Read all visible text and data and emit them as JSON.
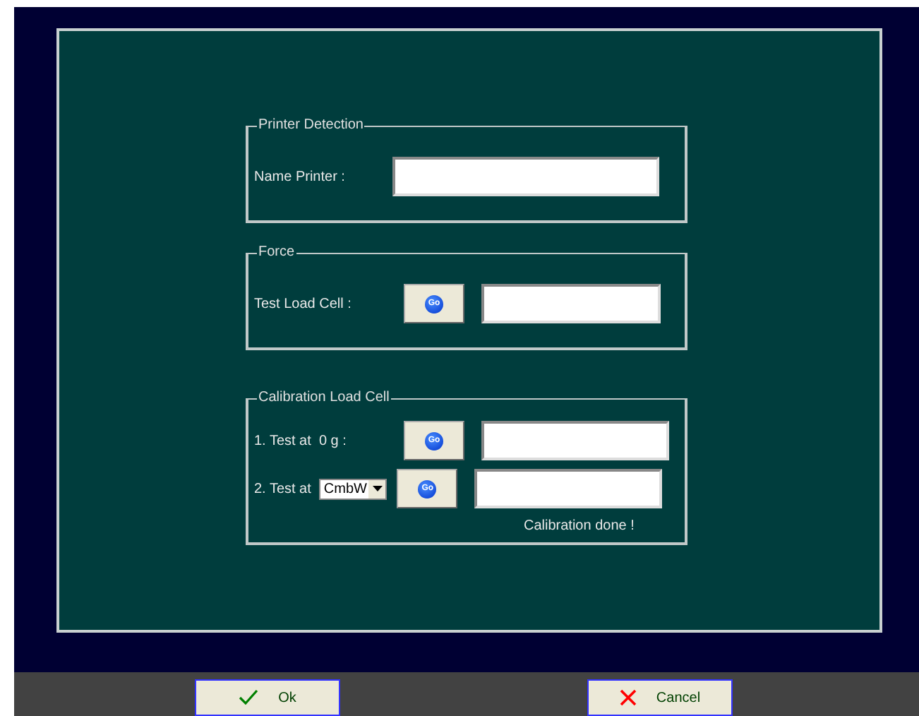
{
  "groups": [
    {
      "kind": "printer",
      "legend": "Printer Detection",
      "rows": [
        {
          "label": "Name Printer :",
          "button": null
        }
      ]
    },
    {
      "kind": "force",
      "legend": "Force",
      "rows": [
        {
          "label": "Test Load Cell :",
          "button": "Go"
        }
      ]
    },
    {
      "kind": "calibration",
      "legend": "Calibration Load Cell",
      "rows": [
        {
          "label": "1. Test at  0 g :",
          "button": "Go"
        },
        {
          "label": "2. Test at",
          "select": "CmbW",
          "button": "Go"
        }
      ],
      "status": "Calibration done !"
    }
  ],
  "buttons": [
    {
      "kind": "ok",
      "label": "Ok"
    },
    {
      "kind": "cancel",
      "label": "Cancel"
    }
  ]
}
